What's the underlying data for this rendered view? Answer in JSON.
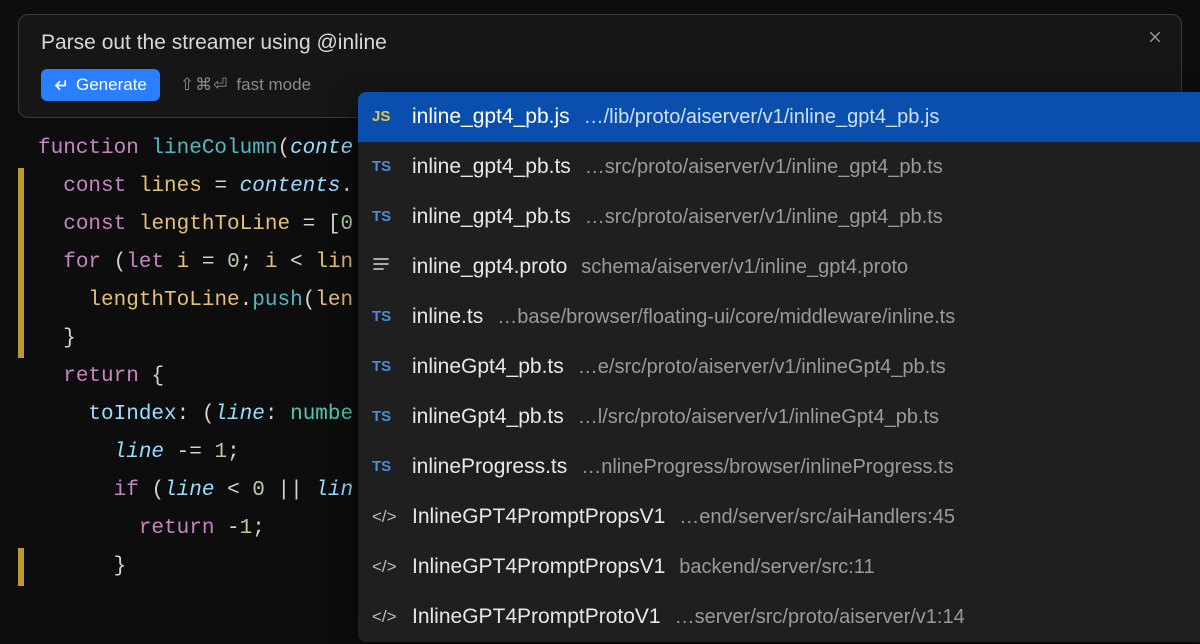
{
  "prompt": {
    "text": "Parse out the streamer using @inline",
    "generate_label": "Generate",
    "fast_mode_label": "fast mode",
    "fast_mode_shortcut": "⇧⌘⏎"
  },
  "code": {
    "lines": [
      {
        "gutter": false,
        "tokens": [
          {
            "t": "function ",
            "c": "tk-kw"
          },
          {
            "t": "lineColumn",
            "c": "tk-fn"
          },
          {
            "t": "(",
            "c": "tk-punc"
          },
          {
            "t": "conte",
            "c": "tk-param"
          }
        ]
      },
      {
        "gutter": true,
        "indent": 1,
        "tokens": [
          {
            "t": "const ",
            "c": "tk-kw"
          },
          {
            "t": "lines",
            "c": "tk-id"
          },
          {
            "t": " = ",
            "c": "tk-op"
          },
          {
            "t": "contents",
            "c": "tk-param"
          },
          {
            "t": ".",
            "c": "tk-punc"
          }
        ]
      },
      {
        "gutter": true,
        "indent": 1,
        "tokens": [
          {
            "t": "const ",
            "c": "tk-kw"
          },
          {
            "t": "lengthToLine",
            "c": "tk-id"
          },
          {
            "t": " = [",
            "c": "tk-punc"
          },
          {
            "t": "0",
            "c": "tk-num"
          }
        ]
      },
      {
        "gutter": true,
        "indent": 1,
        "tokens": [
          {
            "t": "for ",
            "c": "tk-kw"
          },
          {
            "t": "(",
            "c": "tk-punc"
          },
          {
            "t": "let ",
            "c": "tk-kw"
          },
          {
            "t": "i",
            "c": "tk-id"
          },
          {
            "t": " = ",
            "c": "tk-op"
          },
          {
            "t": "0",
            "c": "tk-num"
          },
          {
            "t": "; ",
            "c": "tk-punc"
          },
          {
            "t": "i",
            "c": "tk-id"
          },
          {
            "t": " < ",
            "c": "tk-op"
          },
          {
            "t": "lin",
            "c": "tk-id"
          }
        ]
      },
      {
        "gutter": true,
        "indent": 2,
        "tokens": [
          {
            "t": "lengthToLine",
            "c": "tk-id"
          },
          {
            "t": ".",
            "c": "tk-punc"
          },
          {
            "t": "push",
            "c": "tk-call"
          },
          {
            "t": "(",
            "c": "tk-punc"
          },
          {
            "t": "len",
            "c": "tk-id"
          }
        ]
      },
      {
        "gutter": true,
        "indent": 1,
        "tokens": [
          {
            "t": "}",
            "c": "tk-punc"
          }
        ]
      },
      {
        "gutter": false,
        "indent": 1,
        "tokens": [
          {
            "t": "return ",
            "c": "tk-kw"
          },
          {
            "t": "{",
            "c": "tk-punc"
          }
        ]
      },
      {
        "gutter": false,
        "indent": 2,
        "tokens": [
          {
            "t": "toIndex",
            "c": "tk-prop"
          },
          {
            "t": ": (",
            "c": "tk-punc"
          },
          {
            "t": "line",
            "c": "tk-param"
          },
          {
            "t": ": ",
            "c": "tk-punc"
          },
          {
            "t": "numbe",
            "c": "tk-type"
          }
        ]
      },
      {
        "gutter": false,
        "indent": 3,
        "tokens": [
          {
            "t": "line",
            "c": "tk-param"
          },
          {
            "t": " -= ",
            "c": "tk-op"
          },
          {
            "t": "1",
            "c": "tk-num"
          },
          {
            "t": ";",
            "c": "tk-punc"
          }
        ]
      },
      {
        "gutter": false,
        "indent": 3,
        "tokens": [
          {
            "t": "if ",
            "c": "tk-kw"
          },
          {
            "t": "(",
            "c": "tk-punc"
          },
          {
            "t": "line",
            "c": "tk-param"
          },
          {
            "t": " < ",
            "c": "tk-op"
          },
          {
            "t": "0",
            "c": "tk-num"
          },
          {
            "t": " || ",
            "c": "tk-op"
          },
          {
            "t": "lin",
            "c": "tk-param"
          }
        ]
      },
      {
        "gutter": false,
        "indent": 4,
        "tokens": [
          {
            "t": "return ",
            "c": "tk-kw"
          },
          {
            "t": "-",
            "c": "tk-op"
          },
          {
            "t": "1",
            "c": "tk-num"
          },
          {
            "t": ";",
            "c": "tk-punc"
          }
        ]
      },
      {
        "gutter": true,
        "indent": 3,
        "tokens": [
          {
            "t": "}",
            "c": "tk-punc"
          }
        ]
      }
    ]
  },
  "dropdown": {
    "items": [
      {
        "icon": "JS",
        "icon_class": "ic-js",
        "name": "inline_gpt4_pb.js",
        "path": "…/lib/proto/aiserver/v1/inline_gpt4_pb.js",
        "selected": true
      },
      {
        "icon": "TS",
        "icon_class": "ic-ts",
        "name": "inline_gpt4_pb.ts",
        "path": "…src/proto/aiserver/v1/inline_gpt4_pb.ts"
      },
      {
        "icon": "TS",
        "icon_class": "ic-ts",
        "name": "inline_gpt4_pb.ts",
        "path": "…src/proto/aiserver/v1/inline_gpt4_pb.ts"
      },
      {
        "icon": "proto",
        "icon_class": "ic-proto",
        "name": "inline_gpt4.proto",
        "path": "schema/aiserver/v1/inline_gpt4.proto"
      },
      {
        "icon": "TS",
        "icon_class": "ic-ts",
        "name": "inline.ts",
        "path": "…base/browser/floating-ui/core/middleware/inline.ts"
      },
      {
        "icon": "TS",
        "icon_class": "ic-ts",
        "name": "inlineGpt4_pb.ts",
        "path": "…e/src/proto/aiserver/v1/inlineGpt4_pb.ts"
      },
      {
        "icon": "TS",
        "icon_class": "ic-ts",
        "name": "inlineGpt4_pb.ts",
        "path": "…l/src/proto/aiserver/v1/inlineGpt4_pb.ts"
      },
      {
        "icon": "TS",
        "icon_class": "ic-ts",
        "name": "inlineProgress.ts",
        "path": "…nlineProgress/browser/inlineProgress.ts"
      },
      {
        "icon": "sym",
        "icon_class": "ic-sym",
        "name": "InlineGPT4PromptPropsV1",
        "path": "…end/server/src/aiHandlers:45"
      },
      {
        "icon": "sym",
        "icon_class": "ic-sym",
        "name": "InlineGPT4PromptPropsV1",
        "path": "backend/server/src:11"
      },
      {
        "icon": "sym",
        "icon_class": "ic-sym",
        "name": "InlineGPT4PromptProtoV1",
        "path": "…server/src/proto/aiserver/v1:14"
      }
    ]
  }
}
